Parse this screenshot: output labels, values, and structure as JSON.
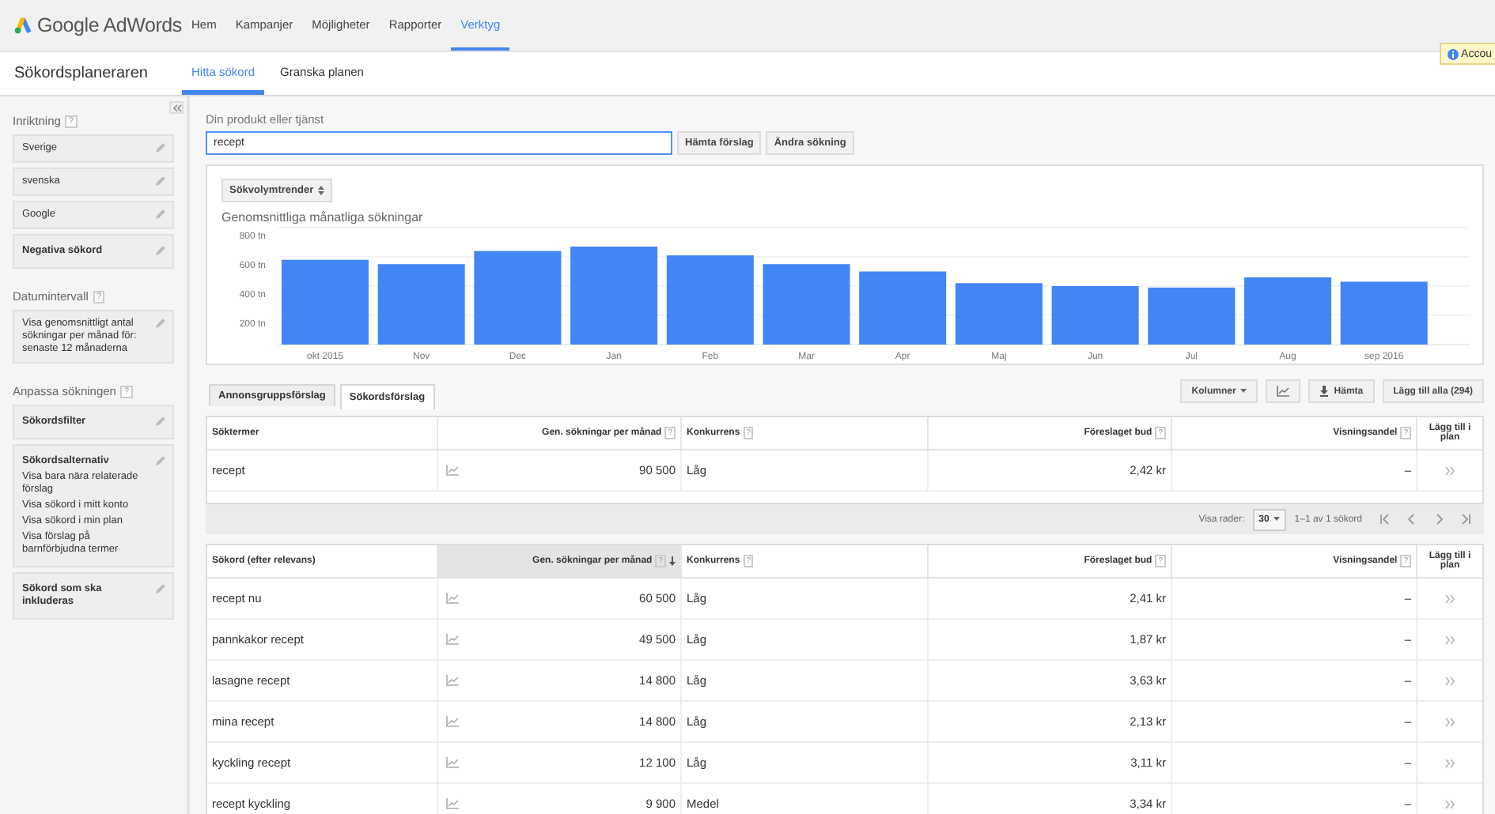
{
  "header": {
    "logo": "Google AdWords",
    "nav": [
      {
        "label": "Hem",
        "selected": false
      },
      {
        "label": "Kampanjer",
        "selected": false
      },
      {
        "label": "Möjligheter",
        "selected": false
      },
      {
        "label": "Rapporter",
        "selected": false
      },
      {
        "label": "Verktyg",
        "selected": true
      }
    ]
  },
  "notice": {
    "text": "Accou"
  },
  "subheader": {
    "title": "Sökordsplaneraren",
    "tabs": [
      {
        "label": "Hitta sökord",
        "selected": true
      },
      {
        "label": "Granska planen",
        "selected": false
      }
    ]
  },
  "sidebar": {
    "sections": [
      {
        "heading": "Inriktning",
        "help": "?",
        "cards": [
          {
            "kind": "value",
            "text": "Sverige"
          },
          {
            "kind": "value",
            "text": "svenska"
          },
          {
            "kind": "value",
            "text": "Google"
          },
          {
            "kind": "setting",
            "text": "Negativa sökord"
          }
        ]
      },
      {
        "heading": "Datumintervall",
        "help": "?",
        "cards": [
          {
            "kind": "value",
            "text": "Visa genomsnittligt antal sökningar per månad för: senaste 12 månaderna"
          }
        ]
      },
      {
        "heading": "Anpassa sökningen",
        "help": "?",
        "cards": [
          {
            "kind": "setting",
            "text": "Sökordsfilter"
          },
          {
            "kind": "options",
            "text": "Sökordsalternativ",
            "options": [
              "Visa bara nära relaterade förslag",
              "Visa sökord i mitt konto",
              "Visa sökord i min plan",
              "Visa förslag på barnförbjudna termer"
            ]
          },
          {
            "kind": "setting",
            "text": "Sökord som ska inkluderas"
          }
        ]
      }
    ]
  },
  "search": {
    "label": "Din produkt eller tjänst",
    "value": "recept",
    "buttons": [
      "Hämta förslag",
      "Ändra sökning"
    ]
  },
  "chart": {
    "dropdown": "Sökvolymtrender",
    "chart_data": {
      "type": "bar",
      "title": "Genomsnittliga månatliga sökningar",
      "categories": [
        "okt 2015",
        "Nov",
        "Dec",
        "Jan",
        "Feb",
        "Mar",
        "Apr",
        "Maj",
        "Jun",
        "Jul",
        "Aug",
        "sep 2016"
      ],
      "series": [
        {
          "color": "#4285f4",
          "values": [
            580,
            550,
            640,
            670,
            610,
            550,
            500,
            420,
            400,
            390,
            460,
            430
          ]
        }
      ],
      "grid": true,
      "ylim": [
        0,
        800
      ],
      "yticks": [
        {
          "value": 200,
          "label": "200 tn"
        },
        {
          "value": 400,
          "label": "400 tn"
        },
        {
          "value": 600,
          "label": "600 tn"
        },
        {
          "value": 800,
          "label": "800 tn"
        }
      ]
    }
  },
  "results": {
    "tabs": [
      {
        "label": "Annonsgruppsförslag",
        "selected": false
      },
      {
        "label": "Sökordsförslag",
        "selected": true
      }
    ],
    "actions": [
      {
        "kind": "menu",
        "label": "Kolumner"
      },
      {
        "kind": "chart"
      },
      {
        "kind": "download",
        "label": "Hämta"
      },
      {
        "kind": "plain",
        "label": "Lägg till alla (294)"
      }
    ],
    "search_terms_table": {
      "columns": [
        {
          "label": "Söktermer"
        },
        {
          "label": "Gen. sökningar per månad",
          "help": "?"
        },
        {
          "label": "Konkurrens",
          "help": "?"
        },
        {
          "label": "Föreslaget bud",
          "help": "?"
        },
        {
          "label": "Visningsandel",
          "help": "?"
        },
        {
          "label": "Lägg till i plan"
        }
      ],
      "rows": [
        {
          "keyword": "recept",
          "searches": "90 500",
          "competition": "Låg",
          "bid": "2,42 kr",
          "share": "–"
        }
      ]
    },
    "pagination": {
      "label": "Visa rader:",
      "rows_per_page": "30",
      "range": "1–1 av 1 sökord"
    },
    "keywords_table": {
      "columns": [
        {
          "label": "Sökord (efter relevans)",
          "sorted": false
        },
        {
          "label": "Gen. sökningar per månad",
          "help": "?",
          "sorted": true
        },
        {
          "label": "Konkurrens",
          "help": "?",
          "sorted": false
        },
        {
          "label": "Föreslaget bud",
          "help": "?",
          "sorted": false
        },
        {
          "label": "Visningsandel",
          "help": "?",
          "sorted": false
        },
        {
          "label": "Lägg till i plan",
          "sorted": false
        }
      ],
      "rows": [
        {
          "keyword": "recept nu",
          "searches": "60 500",
          "competition": "Låg",
          "bid": "2,41 kr",
          "share": "–"
        },
        {
          "keyword": "pannkakor recept",
          "searches": "49 500",
          "competition": "Låg",
          "bid": "1,87 kr",
          "share": "–"
        },
        {
          "keyword": "lasagne recept",
          "searches": "14 800",
          "competition": "Låg",
          "bid": "3,63 kr",
          "share": "–"
        },
        {
          "keyword": "mina recept",
          "searches": "14 800",
          "competition": "Låg",
          "bid": "2,13 kr",
          "share": "–"
        },
        {
          "keyword": "kyckling recept",
          "searches": "12 100",
          "competition": "Låg",
          "bid": "3,11 kr",
          "share": "–"
        },
        {
          "keyword": "recept kyckling",
          "searches": "9 900",
          "competition": "Medel",
          "bid": "3,34 kr",
          "share": "–"
        }
      ]
    }
  }
}
